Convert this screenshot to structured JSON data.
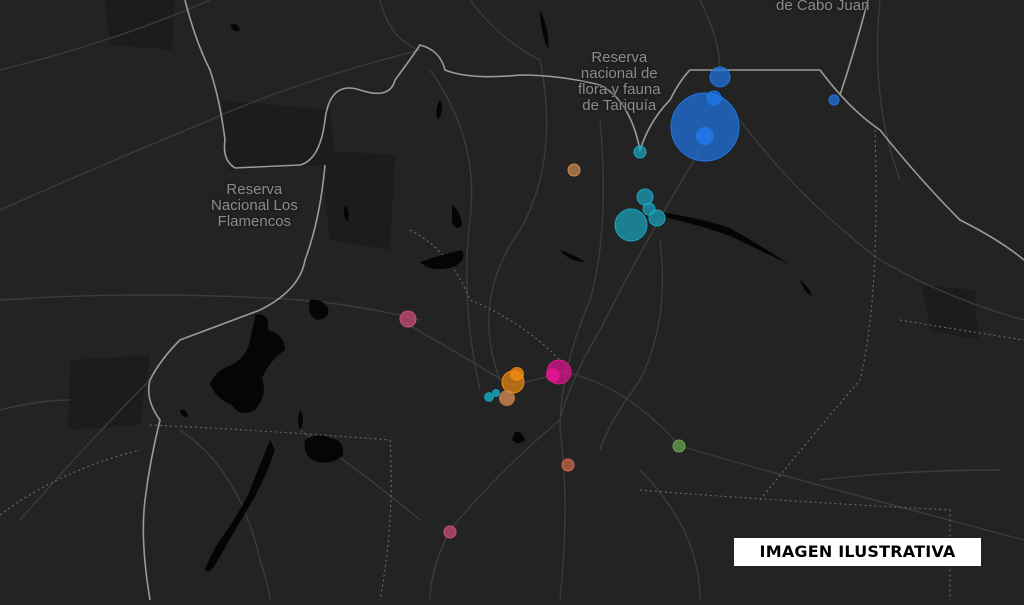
{
  "map": {
    "labels": {
      "cabo_juan": "de Cabo Juan",
      "tariquia": [
        "Reserva",
        "nacional de",
        "flora y fauna",
        "de Tariquía"
      ],
      "flamencos": [
        "Reserva",
        "Nacional Los",
        "Flamencos"
      ]
    },
    "colors": {
      "background": "#232323",
      "road": "#3a3a3a",
      "border": "#9a9a9a",
      "water": "#050505",
      "blue": "#1f77e8",
      "cyan": "#18a6c0",
      "orange": "#f08a10",
      "magenta": "#e2148f",
      "pink": "#d0507a",
      "salmon": "#d06a4a",
      "green": "#6aa84f",
      "tan": "#d08a50"
    },
    "markers": [
      {
        "name": "marker-large-blue",
        "color": "blue"
      },
      {
        "name": "marker-blue-north",
        "color": "blue"
      },
      {
        "name": "marker-blue-small",
        "color": "blue"
      },
      {
        "name": "marker-blue-east",
        "color": "blue"
      },
      {
        "name": "marker-cyan-large",
        "color": "cyan"
      },
      {
        "name": "marker-cyan-a",
        "color": "cyan"
      },
      {
        "name": "marker-cyan-b",
        "color": "cyan"
      },
      {
        "name": "marker-cyan-c",
        "color": "cyan"
      },
      {
        "name": "marker-cyan-d",
        "color": "cyan"
      },
      {
        "name": "marker-orange-cluster",
        "color": "orange"
      },
      {
        "name": "marker-magenta",
        "color": "magenta"
      },
      {
        "name": "marker-pink-west",
        "color": "pink"
      },
      {
        "name": "marker-tan-north",
        "color": "tan"
      },
      {
        "name": "marker-salmon-mid",
        "color": "salmon"
      },
      {
        "name": "marker-salmon-south",
        "color": "pink"
      },
      {
        "name": "marker-green-east",
        "color": "green"
      }
    ]
  },
  "badge": {
    "text": "IMAGEN ILUSTRATIVA"
  }
}
